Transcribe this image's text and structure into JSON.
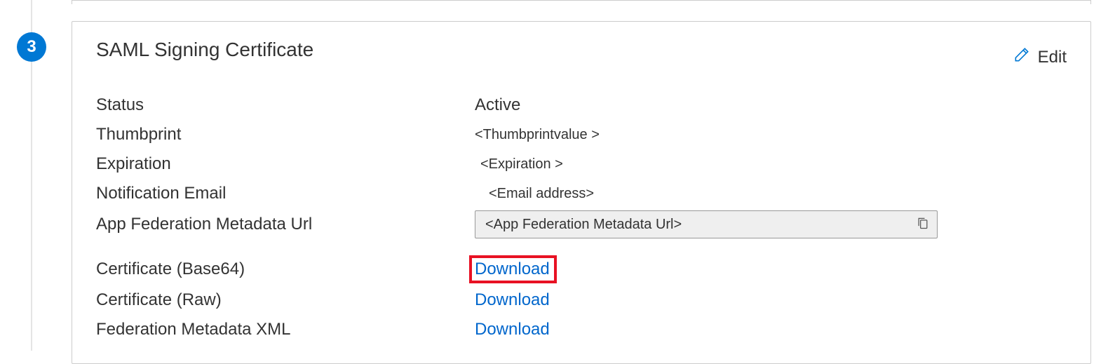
{
  "step": {
    "number": "3"
  },
  "card": {
    "title": "SAML Signing Certificate",
    "edit_label": "Edit",
    "fields": {
      "status_label": "Status",
      "status_value": "Active",
      "thumbprint_label": "Thumbprint",
      "thumbprint_value": "<Thumbprintvalue >",
      "expiration_label": "Expiration",
      "expiration_value": "<Expiration >",
      "notification_email_label": "Notification Email",
      "notification_email_value": "<Email address>",
      "metadata_url_label": "App Federation Metadata Url",
      "metadata_url_value": "<App Federation  Metadata Url>",
      "cert_base64_label": "Certificate (Base64)",
      "cert_base64_link": "Download",
      "cert_raw_label": "Certificate (Raw)",
      "cert_raw_link": "Download",
      "fed_xml_label": "Federation Metadata XML",
      "fed_xml_link": "Download"
    }
  }
}
